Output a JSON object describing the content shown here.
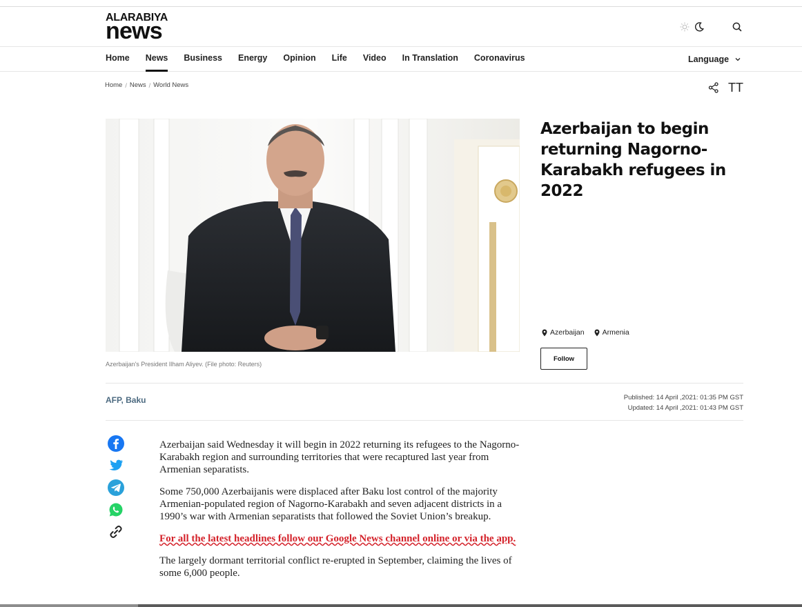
{
  "logo": {
    "line1": "ALARABIYA",
    "line2": "news"
  },
  "nav": {
    "items": [
      {
        "label": "Home",
        "active": false
      },
      {
        "label": "News",
        "active": true
      },
      {
        "label": "Business",
        "active": false
      },
      {
        "label": "Energy",
        "active": false
      },
      {
        "label": "Opinion",
        "active": false
      },
      {
        "label": "Life",
        "active": false
      },
      {
        "label": "Video",
        "active": false
      },
      {
        "label": "In Translation",
        "active": false
      },
      {
        "label": "Coronavirus",
        "active": false
      }
    ],
    "language_label": "Language"
  },
  "breadcrumb": {
    "items": [
      "Home",
      "News",
      "World News"
    ],
    "separator": "/"
  },
  "tools": {
    "font_label": "TT"
  },
  "hero": {
    "caption": "Azerbaijan's President Ilham Aliyev. (File photo: Reuters)"
  },
  "headline": "Azerbaijan to begin returning Nagorno-Karabakh refugees in 2022",
  "tags": [
    "Azerbaijan",
    "Armenia"
  ],
  "follow_label": "Follow",
  "source": "AFP, Baku",
  "dates": {
    "published": "Published: 14 April ,2021: 01:35 PM GST",
    "updated": "Updated: 14 April ,2021: 01:43 PM GST"
  },
  "share_icons": [
    "facebook-icon",
    "twitter-icon",
    "telegram-icon",
    "whatsapp-icon",
    "link-icon"
  ],
  "article": {
    "p1": "Azerbaijan said Wednesday it will begin in 2022 returning its refugees to the Nagorno-Karabakh region and surrounding territories that were recaptured last year from Armenian separatists.",
    "p2": "Some 750,000 Azerbaijanis were displaced after Baku lost control of the majority Armenian-populated region of Nagorno-Karabakh and seven adjacent districts in a 1990’s war with Armenian separatists that followed the Soviet Union’s breakup.",
    "promo": "For all the latest headlines follow our Google News channel online or via the app.",
    "p3": "The largely dormant territorial conflict re-erupted in September, claiming the lives of some 6,000 people."
  },
  "colors": {
    "accent_red": "#d4222a",
    "source_blue": "#4c6a80",
    "facebook": "#1877f2",
    "twitter": "#1da1f2",
    "telegram": "#2aa1da",
    "whatsapp": "#25d366"
  }
}
